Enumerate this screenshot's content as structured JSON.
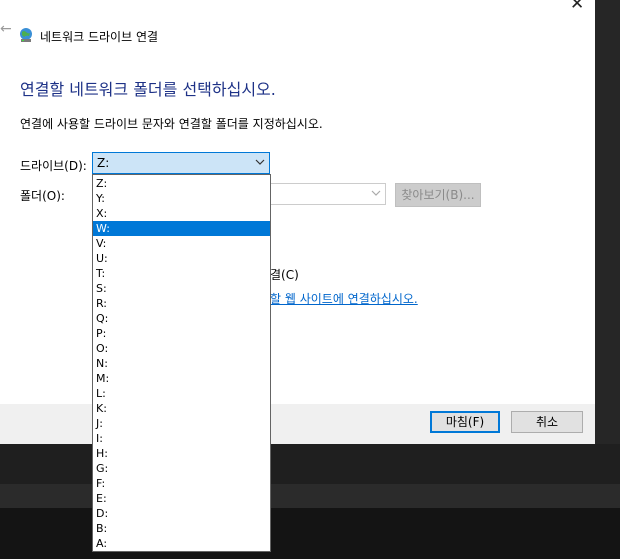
{
  "window": {
    "title": "네트워크 드라이브 연결",
    "back_arrow": "←",
    "close_glyph": "✕"
  },
  "main": {
    "heading": "연결할 네트워크 폴더를 선택하십시오.",
    "description": "연결에 사용할 드라이브 문자와 연결할 폴더를 지정하십시오.",
    "drive_label": "드라이브(D):",
    "drive_value": "Z:",
    "folder_label": "폴더(O):",
    "folder_value": "",
    "browse_label": "찾아보기(B)...",
    "partial_checkbox_text": "결(C)",
    "partial_link_text": "할 웹 사이트에 연결하십시오."
  },
  "footer": {
    "finish_label": "마침(F)",
    "cancel_label": "취소"
  },
  "dropdown": {
    "options": [
      "Z:",
      "Y:",
      "X:",
      "W:",
      "V:",
      "U:",
      "T:",
      "S:",
      "R:",
      "Q:",
      "P:",
      "O:",
      "N:",
      "M:",
      "L:",
      "K:",
      "J:",
      "I:",
      "H:",
      "G:",
      "F:",
      "E:",
      "D:",
      "B:",
      "A:"
    ],
    "highlighted": "W:"
  },
  "colors": {
    "heading": "#1e3287",
    "accent": "#0078d7",
    "select_bg": "#cce4f7",
    "link": "#0066cc"
  },
  "icons": {
    "title_icon": "network-drive-icon",
    "dropdown_chevron": "chevron-down-icon"
  }
}
